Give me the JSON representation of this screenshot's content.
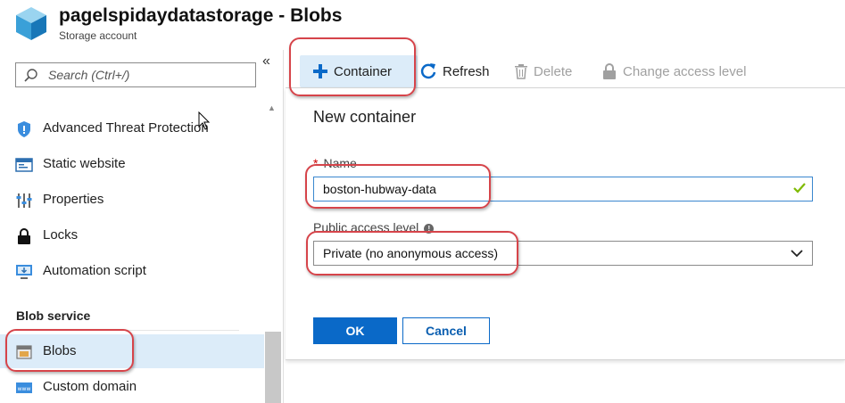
{
  "header": {
    "title": "pagelspidaydatastorage - Blobs",
    "subtitle": "Storage account"
  },
  "sidebar": {
    "search_placeholder": "Search (Ctrl+/)",
    "collapse_glyph": "«",
    "items": [
      {
        "label": "Advanced Threat Protection",
        "icon": "shield-icon"
      },
      {
        "label": "Static website",
        "icon": "website-icon"
      },
      {
        "label": "Properties",
        "icon": "properties-icon"
      },
      {
        "label": "Locks",
        "icon": "lock-icon"
      },
      {
        "label": "Automation script",
        "icon": "automation-icon"
      }
    ],
    "section_header": "Blob service",
    "blob_items": [
      {
        "label": "Blobs",
        "icon": "blobs-icon",
        "selected": true
      },
      {
        "label": "Custom domain",
        "icon": "domain-icon"
      }
    ]
  },
  "toolbar": {
    "container_label": "Container",
    "refresh_label": "Refresh",
    "delete_label": "Delete",
    "access_label": "Change access level"
  },
  "dialog": {
    "title": "New container",
    "name_label": "Name",
    "name_required_mark": "*",
    "name_value": "boston-hubway-data",
    "access_label": "Public access level",
    "access_value": "Private (no anonymous access)",
    "ok_label": "OK",
    "cancel_label": "Cancel"
  },
  "colors": {
    "accent": "#0a69c8",
    "selected_bg": "#dcecf9",
    "highlight": "#d6444a",
    "valid_check": "#7fba00"
  }
}
